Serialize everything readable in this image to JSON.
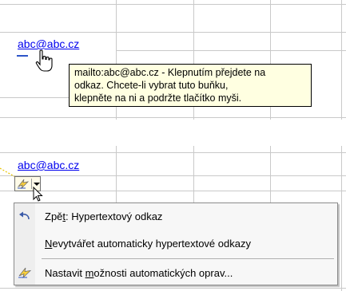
{
  "top_panel": {
    "cell_link_text": "abc@abc.cz",
    "tooltip": {
      "lines": [
        "mailto:abc@abc.cz - Klepnutím přejdete na",
        "odkaz. Chcete-li vybrat tuto buňku,",
        "klepněte na ni a podržte tlačítko myši."
      ]
    }
  },
  "bottom_panel": {
    "cell_link_text": "abc@abc.cz",
    "smart_tag": {
      "icon": "autocorrect-lightning-icon",
      "dropdown": "chevron-down-icon"
    },
    "menu": {
      "items": [
        {
          "pre": "Zpě",
          "acc": "t",
          "post": ": Hypertextový odkaz",
          "icon": "undo-arrow-icon"
        },
        {
          "pre": "",
          "acc": "N",
          "post": "evytvářet automaticky hypertextové odkazy",
          "icon": ""
        },
        {
          "pre": "Nastavit ",
          "acc": "m",
          "post": "ožnosti automatických oprav...",
          "icon": "autocorrect-lightning-icon"
        }
      ]
    }
  },
  "colors": {
    "grid": "#c9c9c9",
    "link": "#0000ee",
    "tooltip_bg": "#ffffe1",
    "menu_bg": "#f7f7f7"
  }
}
